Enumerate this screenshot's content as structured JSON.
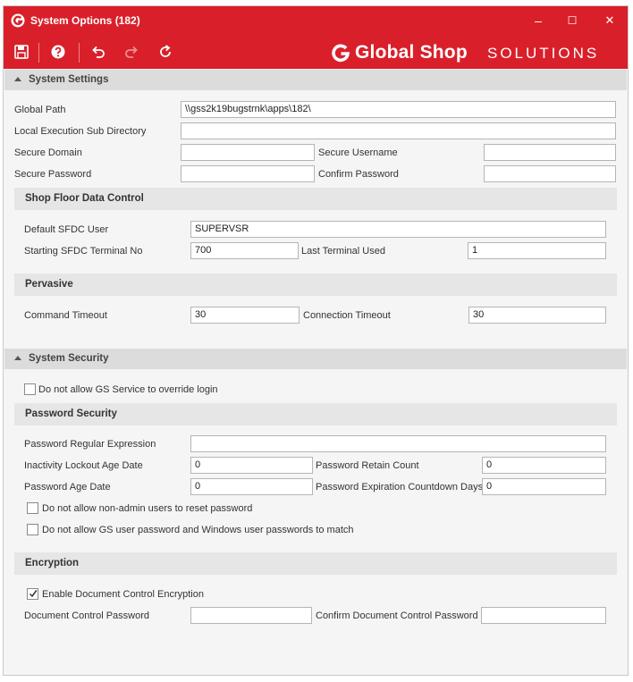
{
  "window": {
    "title": "System Options (182)",
    "controls": {
      "minimize": "–",
      "maximize": "☐",
      "close": "✕"
    }
  },
  "toolbar": {
    "icons": [
      "save-icon",
      "help-icon",
      "undo-icon",
      "redo-icon",
      "refresh-icon"
    ]
  },
  "brand": {
    "strong": "Global Shop",
    "light": "SOLUTIONS"
  },
  "colors": {
    "accent": "#d9202a",
    "section_bg": "#dcdcdc",
    "subsection_bg": "#e6e6e6",
    "background": "#f5f5f5"
  },
  "system_settings": {
    "header": "System Settings",
    "global_path": {
      "label": "Global Path",
      "value": "\\\\gss2k19bugstrnk\\apps\\182\\"
    },
    "local_exec_dir": {
      "label": "Local Execution Sub Directory",
      "value": ""
    },
    "secure_domain": {
      "label": "Secure Domain",
      "value": ""
    },
    "secure_username": {
      "label": "Secure Username",
      "value": ""
    },
    "secure_password": {
      "label": "Secure Password",
      "value": ""
    },
    "confirm_password": {
      "label": "Confirm Password",
      "value": ""
    },
    "sfdc": {
      "header": "Shop Floor Data Control",
      "default_user": {
        "label": "Default SFDC User",
        "value": "SUPERVSR"
      },
      "starting_terminal": {
        "label": "Starting SFDC Terminal No",
        "value": "700"
      },
      "last_terminal": {
        "label": "Last Terminal Used",
        "value": "1"
      }
    },
    "pervasive": {
      "header": "Pervasive",
      "command_timeout": {
        "label": "Command Timeout",
        "value": "30"
      },
      "connection_timeout": {
        "label": "Connection Timeout",
        "value": "30"
      }
    }
  },
  "system_security": {
    "header": "System Security",
    "gs_service_override": {
      "label": "Do not allow GS Service to override login",
      "checked": false
    },
    "password_security": {
      "header": "Password Security",
      "regex": {
        "label": "Password Regular Expression",
        "value": ""
      },
      "inactivity_lockout": {
        "label": "Inactivity Lockout Age Date",
        "value": "0"
      },
      "retain_count": {
        "label": "Password Retain Count",
        "value": "0"
      },
      "age_date": {
        "label": "Password Age Date",
        "value": "0"
      },
      "expiration_countdown": {
        "label": "Password Expiration Countdown Days",
        "value": "0"
      },
      "non_admin_reset": {
        "label": "Do not allow non-admin users to reset password",
        "checked": false
      },
      "gs_windows_match": {
        "label": "Do not allow GS user password and Windows user passwords to match",
        "checked": false
      }
    },
    "encryption": {
      "header": "Encryption",
      "enable_doc_encryption": {
        "label": "Enable Document Control Encryption",
        "checked": true
      },
      "doc_password": {
        "label": "Document Control Password",
        "value": ""
      },
      "confirm_doc_password": {
        "label": "Confirm Document Control Password",
        "value": ""
      }
    }
  }
}
